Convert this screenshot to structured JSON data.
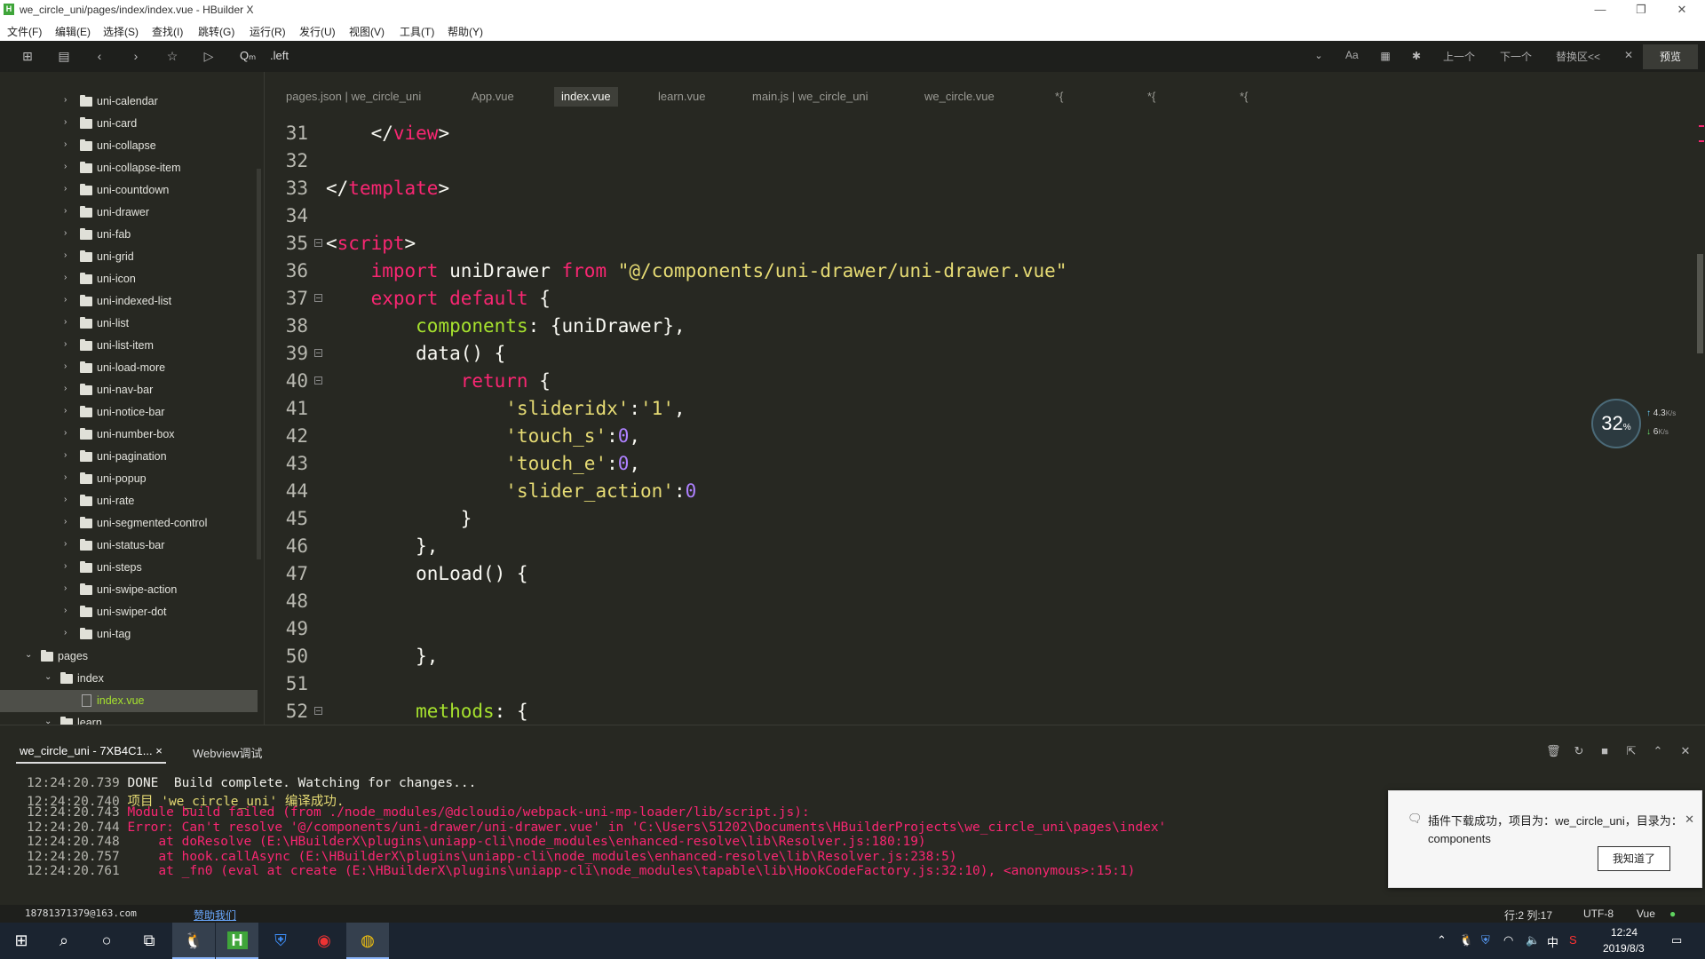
{
  "window": {
    "title": "we_circle_uni/pages/index/index.vue - HBuilder X",
    "app_icon_letter": "H",
    "minimize": "—",
    "maximize": "❐",
    "close": "✕"
  },
  "menu": [
    "文件(F)",
    "编辑(E)",
    "选择(S)",
    "查找(I)",
    "跳转(G)",
    "运行(R)",
    "发行(U)",
    "视图(V)",
    "工具(T)",
    "帮助(Y)"
  ],
  "toolbar": {
    "search_prefix": "Qₘ",
    "search_value": ".left",
    "case_label": "Aa",
    "prev_label": "上一个",
    "next_label": "下一个",
    "replace_label": "替换区<<",
    "close_label": "✕",
    "preview_label": "预览"
  },
  "sidebar": {
    "items": [
      {
        "label": "uni-calendar",
        "type": "folder",
        "depth": 3
      },
      {
        "label": "uni-card",
        "type": "folder",
        "depth": 3
      },
      {
        "label": "uni-collapse",
        "type": "folder",
        "depth": 3
      },
      {
        "label": "uni-collapse-item",
        "type": "folder",
        "depth": 3
      },
      {
        "label": "uni-countdown",
        "type": "folder",
        "depth": 3
      },
      {
        "label": "uni-drawer",
        "type": "folder",
        "depth": 3
      },
      {
        "label": "uni-fab",
        "type": "folder",
        "depth": 3
      },
      {
        "label": "uni-grid",
        "type": "folder",
        "depth": 3
      },
      {
        "label": "uni-icon",
        "type": "folder",
        "depth": 3
      },
      {
        "label": "uni-indexed-list",
        "type": "folder",
        "depth": 3
      },
      {
        "label": "uni-list",
        "type": "folder",
        "depth": 3
      },
      {
        "label": "uni-list-item",
        "type": "folder",
        "depth": 3
      },
      {
        "label": "uni-load-more",
        "type": "folder",
        "depth": 3
      },
      {
        "label": "uni-nav-bar",
        "type": "folder",
        "depth": 3
      },
      {
        "label": "uni-notice-bar",
        "type": "folder",
        "depth": 3
      },
      {
        "label": "uni-number-box",
        "type": "folder",
        "depth": 3
      },
      {
        "label": "uni-pagination",
        "type": "folder",
        "depth": 3
      },
      {
        "label": "uni-popup",
        "type": "folder",
        "depth": 3
      },
      {
        "label": "uni-rate",
        "type": "folder",
        "depth": 3
      },
      {
        "label": "uni-segmented-control",
        "type": "folder",
        "depth": 3
      },
      {
        "label": "uni-status-bar",
        "type": "folder",
        "depth": 3
      },
      {
        "label": "uni-steps",
        "type": "folder",
        "depth": 3
      },
      {
        "label": "uni-swipe-action",
        "type": "folder",
        "depth": 3
      },
      {
        "label": "uni-swiper-dot",
        "type": "folder",
        "depth": 3
      },
      {
        "label": "uni-tag",
        "type": "folder",
        "depth": 3
      },
      {
        "label": "pages",
        "type": "folder-open",
        "depth": 1
      },
      {
        "label": "index",
        "type": "folder-open",
        "depth": 2
      },
      {
        "label": "index.vue",
        "type": "file",
        "depth": 3,
        "selected": true
      },
      {
        "label": "learn",
        "type": "folder-open",
        "depth": 2
      }
    ]
  },
  "tabs": [
    {
      "label": "pages.json | we_circle_uni",
      "active": false
    },
    {
      "label": "App.vue",
      "active": false
    },
    {
      "label": "index.vue",
      "active": true
    },
    {
      "label": "learn.vue",
      "active": false
    },
    {
      "label": "main.js | we_circle_uni",
      "active": false
    },
    {
      "label": "we_circle.vue",
      "active": false
    },
    {
      "label": "*{",
      "active": false
    },
    {
      "label": "*{",
      "active": false
    },
    {
      "label": "*{",
      "active": false
    }
  ],
  "editor": {
    "lines": [
      {
        "n": "31",
        "fold": false,
        "tokens": [
          [
            "    ",
            ""
          ],
          [
            "</",
            "fn"
          ],
          [
            "view",
            "tag"
          ],
          [
            ">",
            "fn"
          ]
        ]
      },
      {
        "n": "32",
        "fold": false,
        "tokens": []
      },
      {
        "n": "33",
        "fold": false,
        "tokens": [
          [
            "</",
            "fn"
          ],
          [
            "template",
            "tag"
          ],
          [
            ">",
            "fn"
          ]
        ]
      },
      {
        "n": "34",
        "fold": false,
        "tokens": []
      },
      {
        "n": "35",
        "fold": true,
        "tokens": [
          [
            "<",
            "fn"
          ],
          [
            "script",
            "tag"
          ],
          [
            ">",
            "fn"
          ]
        ]
      },
      {
        "n": "36",
        "fold": false,
        "tokens": [
          [
            "    ",
            ""
          ],
          [
            "import",
            "kw"
          ],
          [
            " uniDrawer ",
            "fn"
          ],
          [
            "from",
            "kw"
          ],
          [
            " ",
            ""
          ],
          [
            "\"@/components/uni-drawer/uni-drawer.vue\"",
            "str"
          ]
        ]
      },
      {
        "n": "37",
        "fold": true,
        "tokens": [
          [
            "    ",
            ""
          ],
          [
            "export default",
            "kw"
          ],
          [
            " {",
            "fn"
          ]
        ]
      },
      {
        "n": "38",
        "fold": false,
        "tokens": [
          [
            "        ",
            ""
          ],
          [
            "components",
            "prop"
          ],
          [
            ": {uniDrawer},",
            "fn"
          ]
        ]
      },
      {
        "n": "39",
        "fold": true,
        "tokens": [
          [
            "        data() {",
            "fn"
          ]
        ]
      },
      {
        "n": "40",
        "fold": true,
        "tokens": [
          [
            "            ",
            ""
          ],
          [
            "return",
            "kw"
          ],
          [
            " {",
            "fn"
          ]
        ]
      },
      {
        "n": "41",
        "fold": false,
        "tokens": [
          [
            "                ",
            ""
          ],
          [
            "'slideridx'",
            "str"
          ],
          [
            ":",
            "fn"
          ],
          [
            "'1'",
            "str"
          ],
          [
            ",",
            "fn"
          ]
        ]
      },
      {
        "n": "42",
        "fold": false,
        "tokens": [
          [
            "                ",
            ""
          ],
          [
            "'touch_s'",
            "str"
          ],
          [
            ":",
            "fn"
          ],
          [
            "0",
            "num"
          ],
          [
            ",",
            "fn"
          ]
        ]
      },
      {
        "n": "43",
        "fold": false,
        "tokens": [
          [
            "                ",
            ""
          ],
          [
            "'touch_e'",
            "str"
          ],
          [
            ":",
            "fn"
          ],
          [
            "0",
            "num"
          ],
          [
            ",",
            "fn"
          ]
        ]
      },
      {
        "n": "44",
        "fold": false,
        "tokens": [
          [
            "                ",
            ""
          ],
          [
            "'slider_action'",
            "str"
          ],
          [
            ":",
            "fn"
          ],
          [
            "0",
            "num"
          ]
        ]
      },
      {
        "n": "45",
        "fold": false,
        "tokens": [
          [
            "            }",
            "fn"
          ]
        ]
      },
      {
        "n": "46",
        "fold": false,
        "tokens": [
          [
            "        },",
            "fn"
          ]
        ]
      },
      {
        "n": "47",
        "fold": false,
        "tokens": [
          [
            "        onLoad() {",
            "fn"
          ]
        ]
      },
      {
        "n": "48",
        "fold": false,
        "tokens": []
      },
      {
        "n": "49",
        "fold": false,
        "tokens": []
      },
      {
        "n": "50",
        "fold": false,
        "tokens": [
          [
            "        },",
            "fn"
          ]
        ]
      },
      {
        "n": "51",
        "fold": false,
        "tokens": []
      },
      {
        "n": "52",
        "fold": true,
        "tokens": [
          [
            "        ",
            ""
          ],
          [
            "methods",
            "prop"
          ],
          [
            ": {",
            "fn"
          ]
        ]
      }
    ]
  },
  "speed_widget": {
    "cpu": "32",
    "cpu_unit": "%",
    "up": "4.3",
    "down": "6",
    "unit": "K/s"
  },
  "console": {
    "tabs": [
      {
        "label": "we_circle_uni - 7XB4C1...",
        "active": true,
        "close": "×"
      },
      {
        "label": "Webview调试",
        "active": false
      }
    ],
    "lines": [
      {
        "time": "12:24:20.739",
        "text": " DONE  Build complete. Watching for changes...",
        "color": "cwhite"
      },
      {
        "time": "12:24:20.740",
        "text": " 项目 'we_circle_uni' 编译成功.",
        "color": "cyellow"
      },
      {
        "time": "12:24:20.743",
        "text": " Module build failed (from ./node_modules/@dcloudio/webpack-uni-mp-loader/lib/script.js):",
        "color": "cred"
      },
      {
        "time": "12:24:20.744",
        "text": " Error: Can't resolve '@/components/uni-drawer/uni-drawer.vue' in 'C:\\Users\\51202\\Documents\\HBuilderProjects\\we_circle_uni\\pages\\index'",
        "color": "cred"
      },
      {
        "time": "12:24:20.748",
        "text": "     at doResolve (E:\\HBuilderX\\plugins\\uniapp-cli\\node_modules\\enhanced-resolve\\lib\\Resolver.js:180:19)",
        "color": "cred"
      },
      {
        "time": "12:24:20.757",
        "text": "     at hook.callAsync (E:\\HBuilderX\\plugins\\uniapp-cli\\node_modules\\enhanced-resolve\\lib\\Resolver.js:238:5)",
        "color": "cred"
      },
      {
        "time": "12:24:20.761",
        "text": "     at _fn0 (eval at create (E:\\HBuilderX\\plugins\\uniapp-cli\\node_modules\\tapable\\lib\\HookCodeFactory.js:32:10), <anonymous>:15:1)",
        "color": "cred"
      }
    ]
  },
  "notification": {
    "message": "插件下载成功，项目为：we_circle_uni，目录为：components",
    "button": "我知道了",
    "close": "✕"
  },
  "statusbar": {
    "user": "18781371379@163.com",
    "help": "赞助我们",
    "position": "行:2  列:17",
    "encoding": "UTF-8",
    "language": "Vue"
  },
  "taskbar": {
    "time": "12:24",
    "date": "2019/8/3",
    "ime": "中"
  }
}
